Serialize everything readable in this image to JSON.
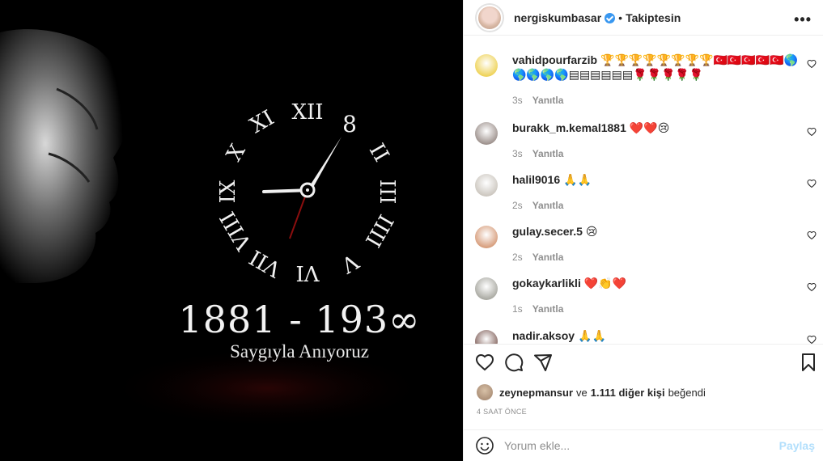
{
  "post": {
    "image": {
      "years_text": "1881 - 193∞",
      "subtitle_text": "Saygıyla Anıyoruz"
    },
    "header": {
      "username": "nergiskumbasar",
      "separator": "•",
      "follow_status": "Takiptesin",
      "more_label": "•••"
    },
    "comments": [
      {
        "username": "vahidpourfarzib",
        "text": "🏆🏆🏆🏆🏆🏆🏆🏆🇹🇷🇹🇷🇹🇷🇹🇷🇹🇷🌎🌎🌎🌎🌎▤▤▤▤▤▤🌹🌹🌹🌹🌹",
        "time": "3s",
        "reply": "Yanıtla",
        "avatar_color": "#e8c21a"
      },
      {
        "username": "burakk_m.kemal1881",
        "text": "❤️❤️😢",
        "time": "3s",
        "reply": "Yanıtla",
        "avatar_color": "#7a6a64"
      },
      {
        "username": "halil9016",
        "text": "🙏🙏",
        "time": "2s",
        "reply": "Yanıtla",
        "avatar_color": "#b9b2a8"
      },
      {
        "username": "gulay.secer.5",
        "text": "😢",
        "time": "2s",
        "reply": "Yanıtla",
        "avatar_color": "#c8794b"
      },
      {
        "username": "gokaykarlikli",
        "text": "❤️👏❤️",
        "time": "1s",
        "reply": "Yanıtla",
        "avatar_color": "#8a8a80"
      },
      {
        "username": "nadir.aksoy",
        "text": "🙏🙏",
        "time": "",
        "reply": "",
        "avatar_color": "#5a3028"
      }
    ],
    "likes": {
      "first_user": "zeynepmansur",
      "connector": "ve",
      "others": "1.111 diğer kişi",
      "suffix": "beğendi"
    },
    "timestamp": "4 SAAT ÖNCE",
    "comment_input": {
      "placeholder": "Yorum ekle...",
      "post_label": "Paylaş"
    }
  }
}
